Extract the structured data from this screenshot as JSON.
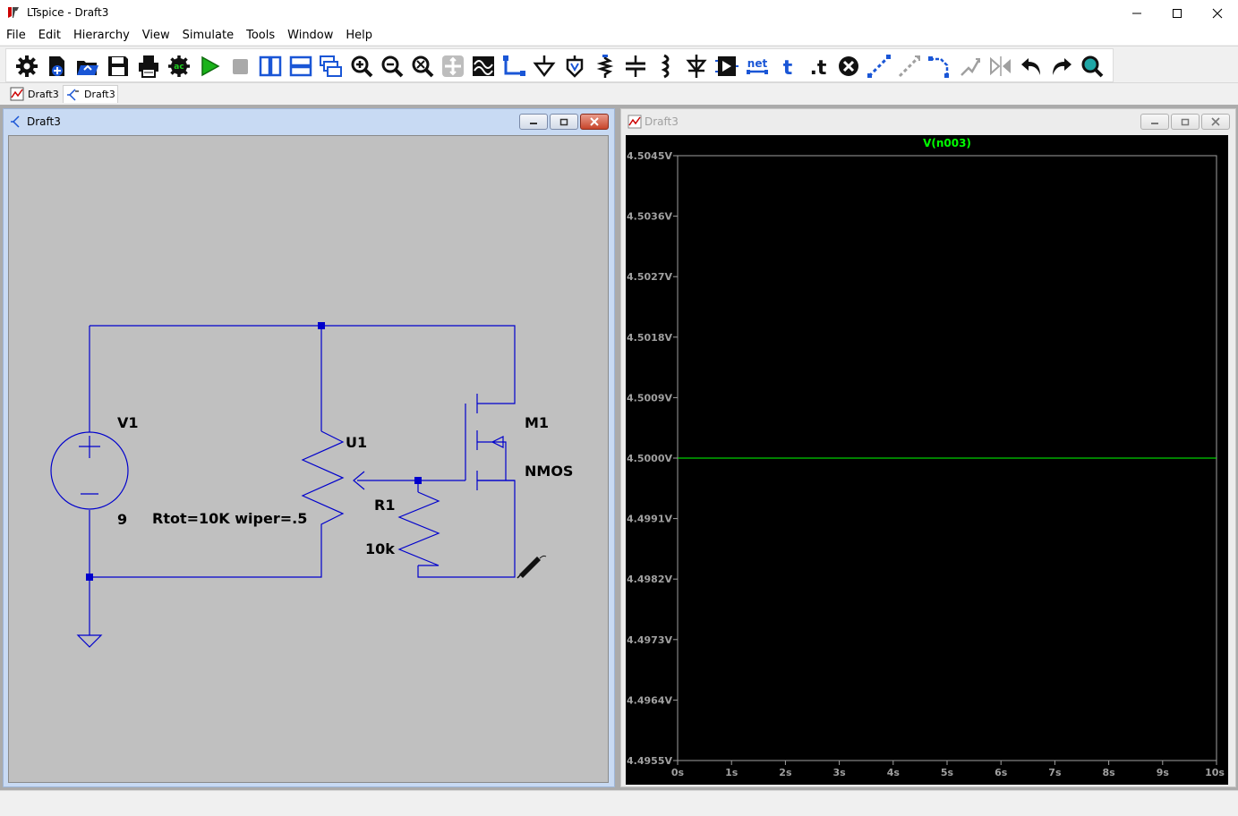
{
  "window": {
    "title": "LTspice - Draft3"
  },
  "menu": [
    "File",
    "Edit",
    "Hierarchy",
    "View",
    "Simulate",
    "Tools",
    "Window",
    "Help"
  ],
  "toolbar": {
    "buttons": [
      {
        "name": "control-panel-icon"
      },
      {
        "name": "new-schematic-icon"
      },
      {
        "name": "open-icon"
      },
      {
        "name": "save-icon"
      },
      {
        "name": "print-icon"
      },
      {
        "name": "ac-analysis-icon"
      },
      {
        "name": "run-icon"
      },
      {
        "name": "halt-icon"
      },
      {
        "name": "tile-vertical-icon"
      },
      {
        "name": "tile-horizontal-icon"
      },
      {
        "name": "cascade-icon"
      },
      {
        "name": "zoom-in-icon"
      },
      {
        "name": "zoom-out-icon"
      },
      {
        "name": "zoom-fit-icon"
      },
      {
        "name": "pan-icon"
      },
      {
        "name": "waveform-icon"
      },
      {
        "name": "wire-icon"
      },
      {
        "name": "ground-icon"
      },
      {
        "name": "label-net-icon"
      },
      {
        "name": "resistor-icon"
      },
      {
        "name": "capacitor-icon"
      },
      {
        "name": "inductor-icon"
      },
      {
        "name": "diode-icon"
      },
      {
        "name": "component-icon"
      },
      {
        "name": "spice-net-icon"
      },
      {
        "name": "text-icon"
      },
      {
        "name": "spice-directive-icon"
      },
      {
        "name": "delete-icon"
      },
      {
        "name": "duplicate-icon"
      },
      {
        "name": "move-icon"
      },
      {
        "name": "drag-icon"
      },
      {
        "name": "rotate-icon"
      },
      {
        "name": "mirror-icon"
      },
      {
        "name": "undo-icon"
      },
      {
        "name": "redo-icon"
      },
      {
        "name": "find-icon"
      }
    ],
    "net_label": "net",
    "text_label": "t",
    "directive_label": ".t",
    "ac_label": "ac"
  },
  "tabs": [
    {
      "label": "Draft3",
      "kind": "waveform",
      "active": false
    },
    {
      "label": "Draft3",
      "kind": "schematic",
      "active": true
    }
  ],
  "schematic_window": {
    "title": "Draft3",
    "components": {
      "v1_name": "V1",
      "v1_value": "9",
      "u1_name": "U1",
      "u1_value": "Rtot=10K wiper=.5",
      "r1_name": "R1",
      "r1_value": "10k",
      "m1_name": "M1",
      "m1_value": "NMOS"
    },
    "wire_color": "#0000cc"
  },
  "waveform_window": {
    "title": "Draft3"
  },
  "chart_data": {
    "type": "line",
    "title": "",
    "trace_label": "V(n003)",
    "series": [
      {
        "name": "V(n003)",
        "color": "#00ff00",
        "x": [
          0,
          10
        ],
        "y": [
          4.5,
          4.5
        ]
      }
    ],
    "xlim": [
      0,
      10
    ],
    "ylim": [
      4.4955,
      4.5045
    ],
    "x_ticks": [
      "0s",
      "1s",
      "2s",
      "3s",
      "4s",
      "5s",
      "6s",
      "7s",
      "8s",
      "9s",
      "10s"
    ],
    "y_ticks": [
      "4.5045V",
      "4.5036V",
      "4.5027V",
      "4.5018V",
      "4.5009V",
      "4.5000V",
      "4.4991V",
      "4.4982V",
      "4.4973V",
      "4.4964V",
      "4.4955V"
    ],
    "grid": false,
    "background": "#000000",
    "axis_color": "#a0a0a0",
    "label_color": "#a0a0a0"
  }
}
